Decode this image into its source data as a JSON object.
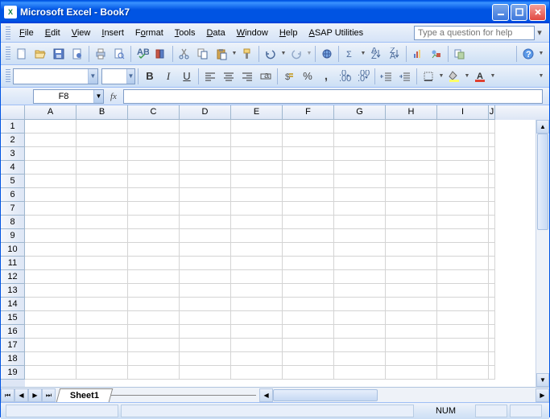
{
  "title": "Microsoft Excel - Book7",
  "menus": [
    "File",
    "Edit",
    "View",
    "Insert",
    "Format",
    "Tools",
    "Data",
    "Window",
    "Help",
    "ASAP Utilities"
  ],
  "help_placeholder": "Type a question for help",
  "namebox": "F8",
  "fx_label": "fx",
  "columns": [
    "A",
    "B",
    "C",
    "D",
    "E",
    "F",
    "G",
    "H",
    "I",
    "J"
  ],
  "rows": [
    "1",
    "2",
    "3",
    "4",
    "5",
    "6",
    "7",
    "8",
    "9",
    "10",
    "11",
    "12",
    "13",
    "14",
    "15",
    "16",
    "17",
    "18",
    "19"
  ],
  "sheet_tab": "Sheet1",
  "status_num": "NUM"
}
